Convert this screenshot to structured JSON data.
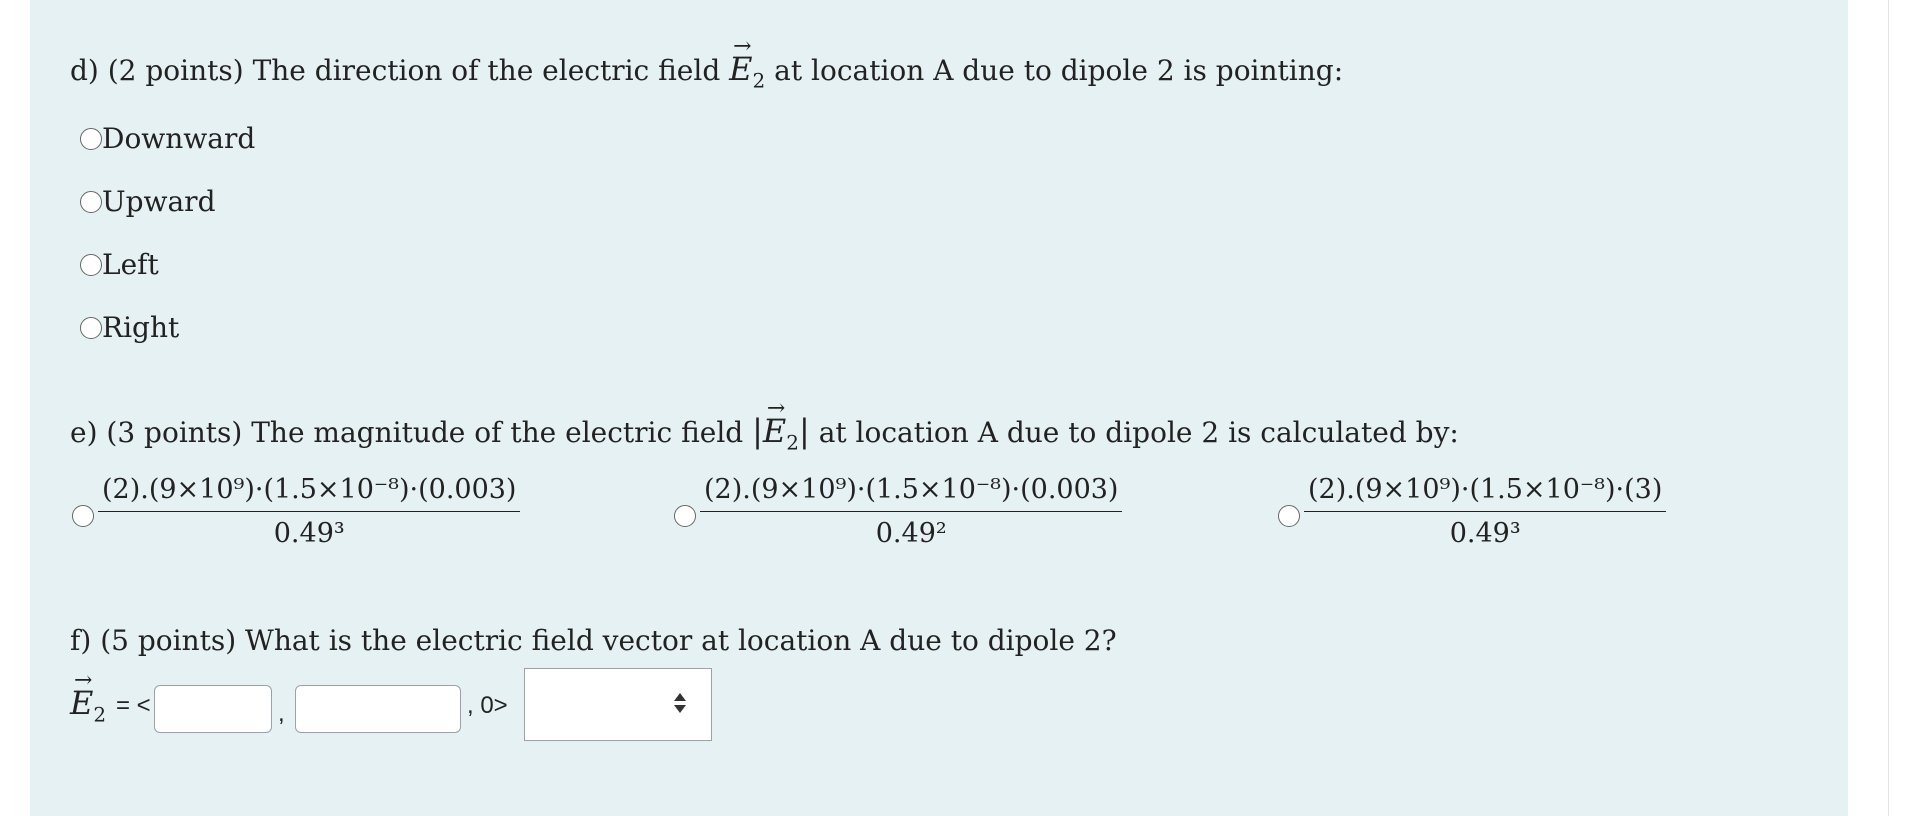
{
  "question_d": {
    "text_pre": "d) (2 points) The direction of the electric field",
    "symbol": "E",
    "subscript": "2",
    "text_post": "at location A due to dipole 2 is pointing:",
    "options": [
      "Downward",
      "Upward",
      "Left",
      "Right"
    ]
  },
  "question_e": {
    "text_pre": "e) (3 points) The magnitude of the electric field",
    "symbol": "E",
    "subscript": "2",
    "text_post": "at location A due to dipole 2 is calculated by:",
    "options": [
      {
        "numerator": "(2).(9×10⁹)·(1.5×10⁻⁸)·(0.003)",
        "denominator": "0.49³"
      },
      {
        "numerator": "(2).(9×10⁹)·(1.5×10⁻⁸)·(0.003)",
        "denominator": "0.49²"
      },
      {
        "numerator": "(2).(9×10⁹)·(1.5×10⁻⁸)·(3)",
        "denominator": "0.49³"
      }
    ]
  },
  "question_f": {
    "text": "f) (5 points) What is the electric field vector at location A due to dipole 2?",
    "symbol": "E",
    "subscript": "2",
    "equals": "= <",
    "comma": ",",
    "tail": ", 0>",
    "field_x_value": "",
    "field_y_value": "",
    "unit_select_value": ""
  }
}
